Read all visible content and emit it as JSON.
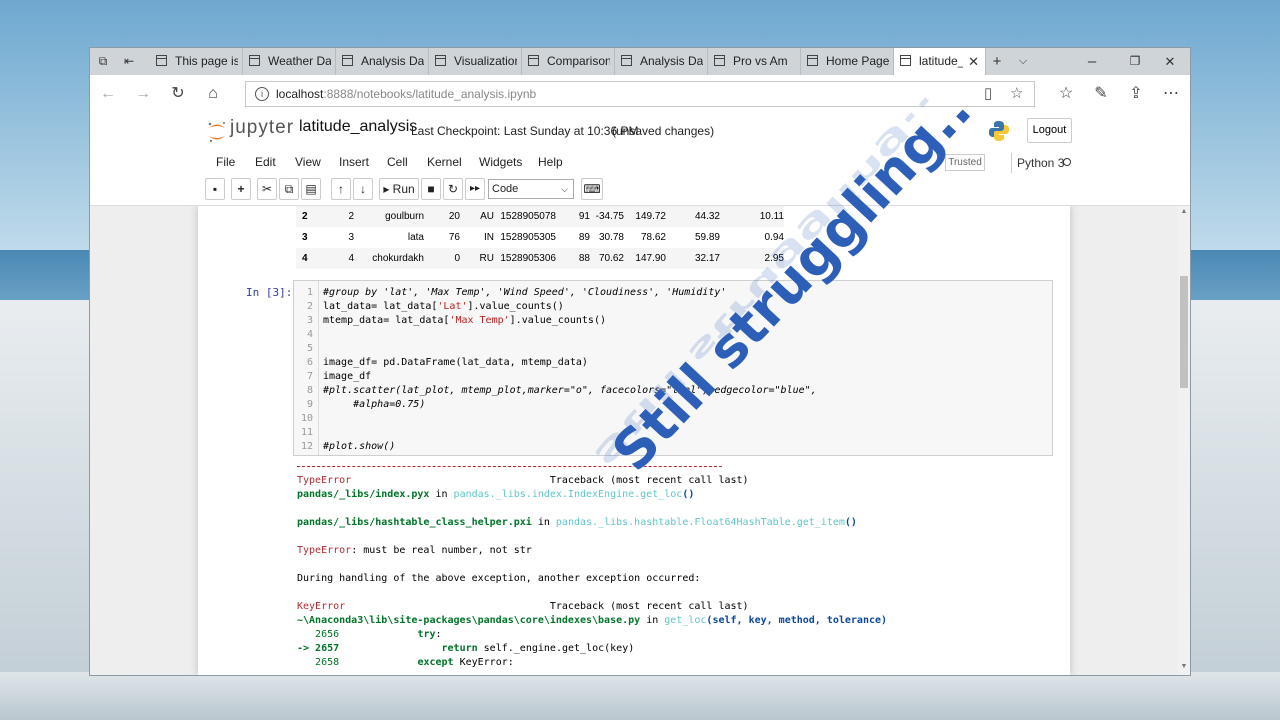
{
  "browser": {
    "tabs": [
      {
        "label": "This page is l",
        "active": false
      },
      {
        "label": "Weather Das",
        "active": false
      },
      {
        "label": "Analysis Data",
        "active": false
      },
      {
        "label": "Visualization",
        "active": false
      },
      {
        "label": "Comparisons",
        "active": false
      },
      {
        "label": "Analysis Data",
        "active": false
      },
      {
        "label": "Pro vs Am",
        "active": false
      },
      {
        "label": "Home Page -",
        "active": false
      },
      {
        "label": "latitude_",
        "active": true
      }
    ],
    "url_host": "localhost",
    "url_rest": ":8888/notebooks/latitude_analysis.ipynb"
  },
  "jupyter": {
    "logo_text": "jupyter",
    "notebook_name": "latitude_analysis",
    "checkpoint": "Last Checkpoint: Last Sunday at 10:36 PM",
    "unsaved": "(unsaved changes)",
    "logout": "Logout",
    "menu": [
      "File",
      "Edit",
      "View",
      "Insert",
      "Cell",
      "Kernel",
      "Widgets",
      "Help"
    ],
    "trusted": "Trusted",
    "kernel": "Python 3",
    "run_label": "Run",
    "cell_type": "Code"
  },
  "dataframe_rows": [
    [
      "2",
      "2",
      "goulburn",
      "20",
      "AU",
      "1528905078",
      "91",
      "-34.75",
      "149.72",
      "44.32",
      "10.11"
    ],
    [
      "3",
      "3",
      "lata",
      "76",
      "IN",
      "1528905305",
      "89",
      "30.78",
      "78.62",
      "59.89",
      "0.94"
    ],
    [
      "4",
      "4",
      "chokurdakh",
      "0",
      "RU",
      "1528905306",
      "88",
      "70.62",
      "147.90",
      "32.17",
      "2.95"
    ]
  ],
  "cell": {
    "prompt": "In [3]:"
  },
  "overlay_text": "Still struggling..",
  "colors": {
    "overlay": "#2e5fb8",
    "error_red": "#b22b31",
    "traceback_green": "#007427",
    "traceback_cyan": "#60c6c8",
    "prompt_blue": "#303f9f"
  }
}
